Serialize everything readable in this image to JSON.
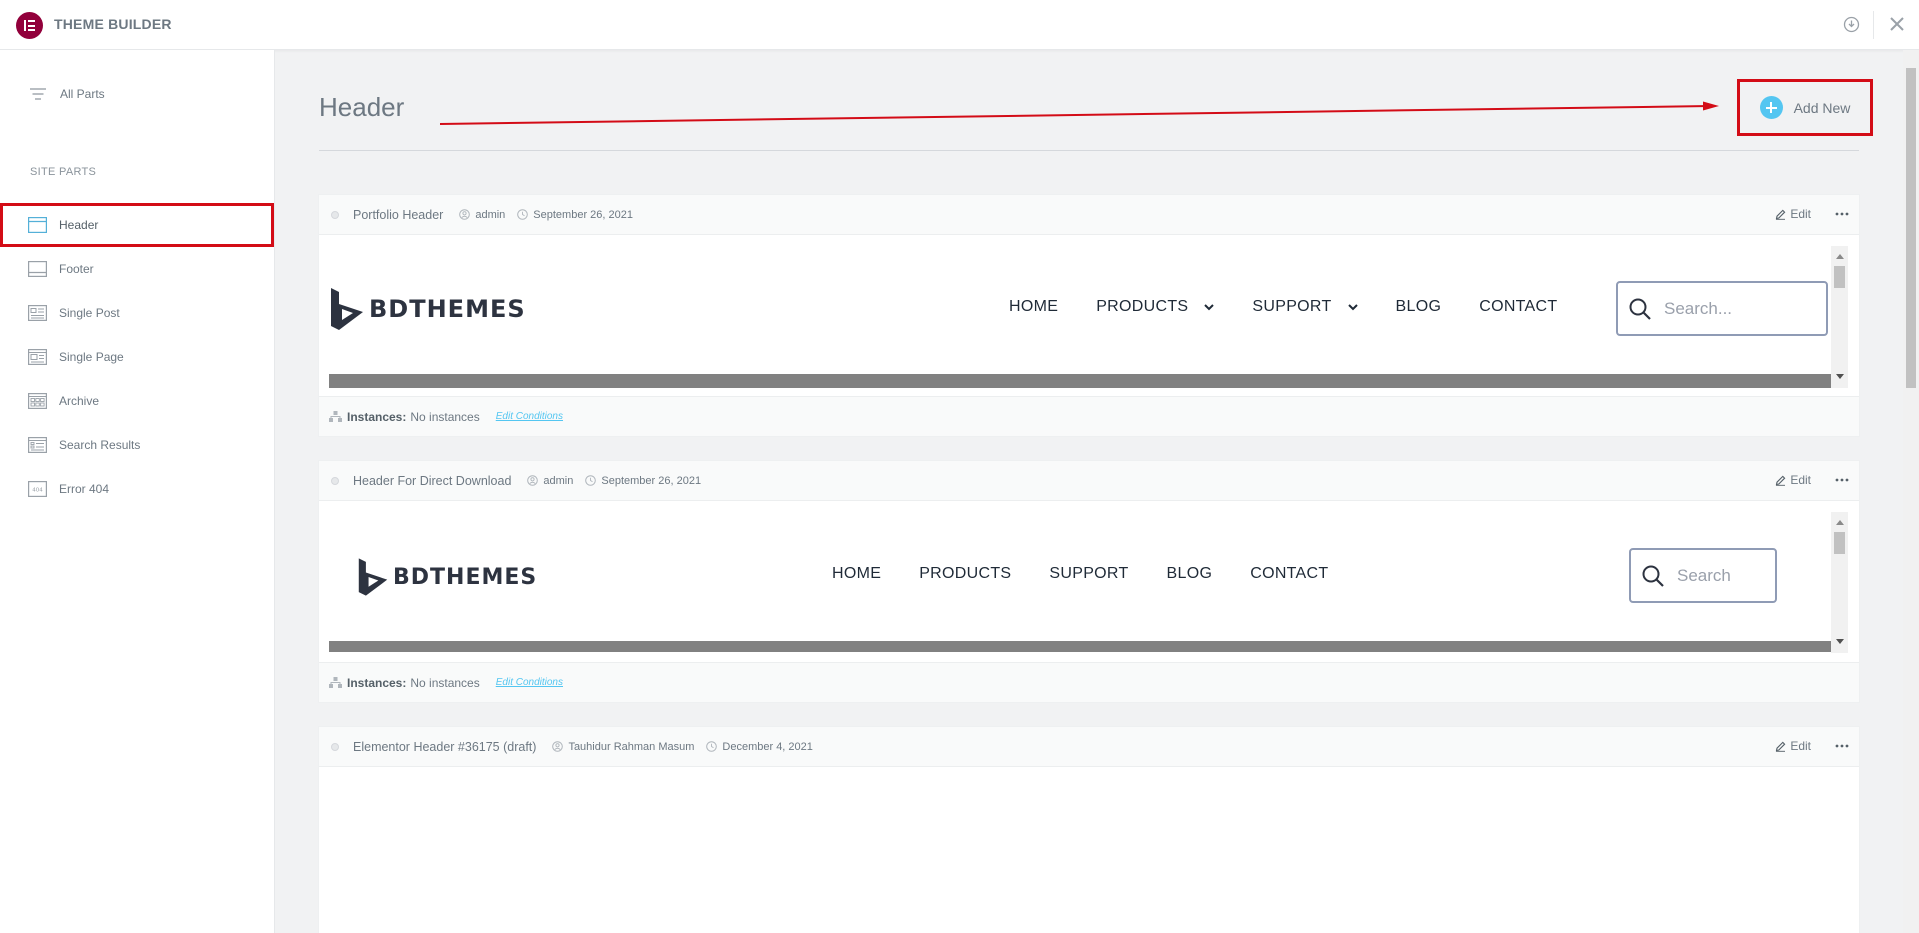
{
  "app": {
    "title": "THEME BUILDER"
  },
  "sidebar": {
    "all_parts": "All Parts",
    "section_title": "SITE PARTS",
    "items": [
      {
        "label": "Header",
        "icon": "header-layout-icon",
        "active": true
      },
      {
        "label": "Footer",
        "icon": "footer-layout-icon"
      },
      {
        "label": "Single Post",
        "icon": "single-post-icon"
      },
      {
        "label": "Single Page",
        "icon": "single-page-icon"
      },
      {
        "label": "Archive",
        "icon": "archive-grid-icon"
      },
      {
        "label": "Search Results",
        "icon": "search-results-icon"
      },
      {
        "label": "Error 404",
        "icon": "error-404-icon"
      }
    ]
  },
  "main": {
    "title": "Header",
    "add_new": "Add New",
    "cards": [
      {
        "title": "Portfolio Header",
        "author": "admin",
        "date": "September 26, 2021",
        "edit": "Edit",
        "instances_label": "Instances:",
        "instances_value": "No instances",
        "edit_conditions": "Edit Conditions",
        "preview": {
          "brand": "BDTHEMES",
          "nav": [
            "HOME",
            "PRODUCTS",
            "SUPPORT",
            "BLOG",
            "CONTACT"
          ],
          "search_placeholder": "Search..."
        }
      },
      {
        "title": "Header For Direct Download",
        "author": "admin",
        "date": "September 26, 2021",
        "edit": "Edit",
        "instances_label": "Instances:",
        "instances_value": "No instances",
        "edit_conditions": "Edit Conditions",
        "preview": {
          "brand": "BDTHEMES",
          "nav": [
            "HOME",
            "PRODUCTS",
            "SUPPORT",
            "BLOG",
            "CONTACT"
          ],
          "search_placeholder": "Search"
        }
      },
      {
        "title": "Elementor Header #36175 (draft)",
        "author": "Tauhidur Rahman Masum",
        "date": "December 4, 2021",
        "edit": "Edit"
      }
    ]
  },
  "colors": {
    "brand": "#92003b",
    "accent": "#54c6f1",
    "highlight": "#d30c16"
  }
}
